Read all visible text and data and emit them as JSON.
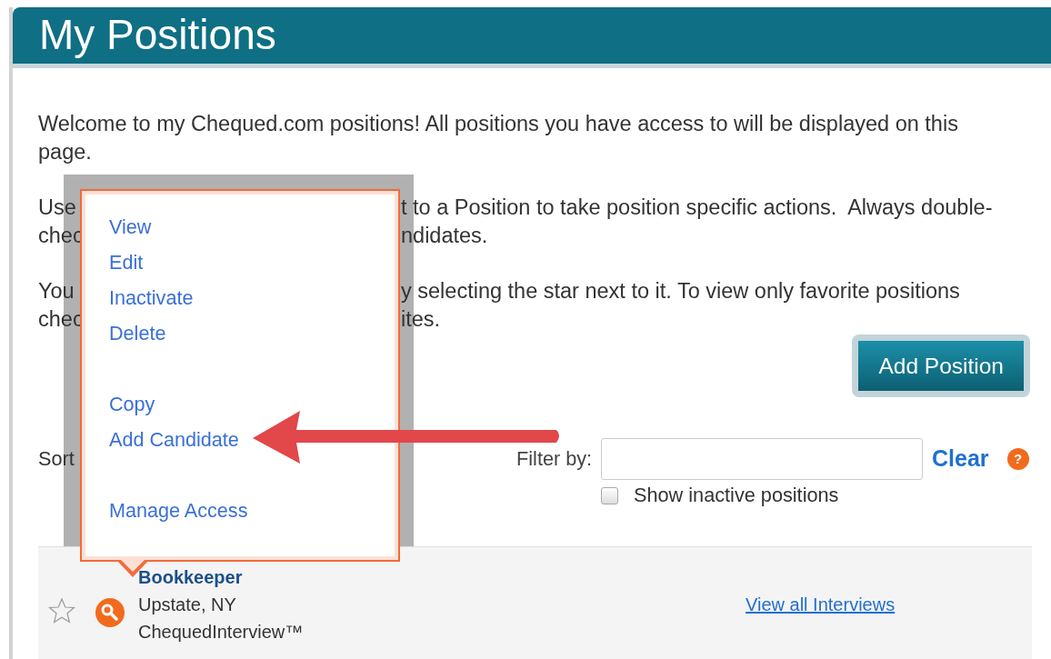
{
  "header": {
    "title": "My Positions"
  },
  "intro": "Welcome to my Chequed.com positions! All positions you have access to will be displayed on this page.",
  "partial_paragraphs": [
    {
      "lines": [
        {
          "left": "Use",
          "right": "t to a Position to take position specific actions.  Always double-"
        },
        {
          "left": "chec",
          "right": "ndidates."
        }
      ]
    },
    {
      "lines": [
        {
          "left": "You",
          "right": "y selecting the star next to it. To view only favorite positions"
        },
        {
          "left": "chec",
          "right": "ites."
        }
      ]
    }
  ],
  "add_button": "Add Position",
  "sort_label": "Sort",
  "filter": {
    "label": "Filter by:",
    "clear": "Clear",
    "help": "?"
  },
  "show_inactive": {
    "label": "Show inactive positions",
    "checked": false
  },
  "positions": [
    {
      "title": "Bookkeeper",
      "location": "Upstate, NY",
      "type": "ChequedInterview™",
      "favorite": false,
      "link": "View all Interviews"
    }
  ],
  "menu": {
    "groups": [
      {
        "items": [
          "View",
          "Edit",
          "Inactivate",
          "Delete"
        ]
      },
      {
        "items": [
          "Copy",
          "Add Candidate"
        ]
      },
      {
        "items": [
          "Manage Access"
        ]
      }
    ]
  }
}
